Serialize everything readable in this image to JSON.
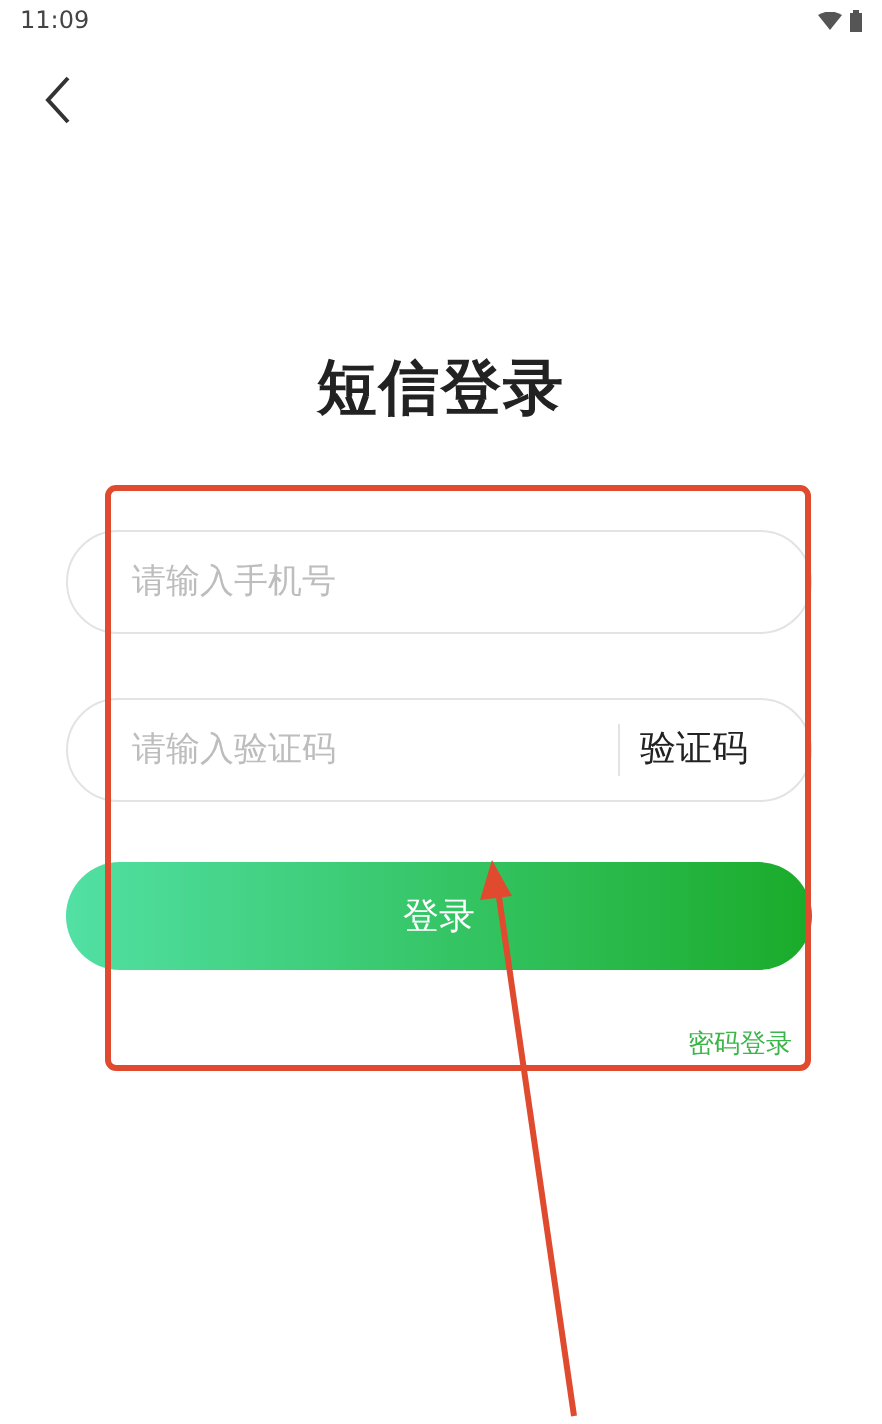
{
  "status_bar": {
    "time": "11:09"
  },
  "title": "短信登录",
  "phone_field": {
    "placeholder": "请输入手机号"
  },
  "code_field": {
    "placeholder": "请输入验证码",
    "button": "验证码"
  },
  "login_button": "登录",
  "password_login_link": "密码登录"
}
